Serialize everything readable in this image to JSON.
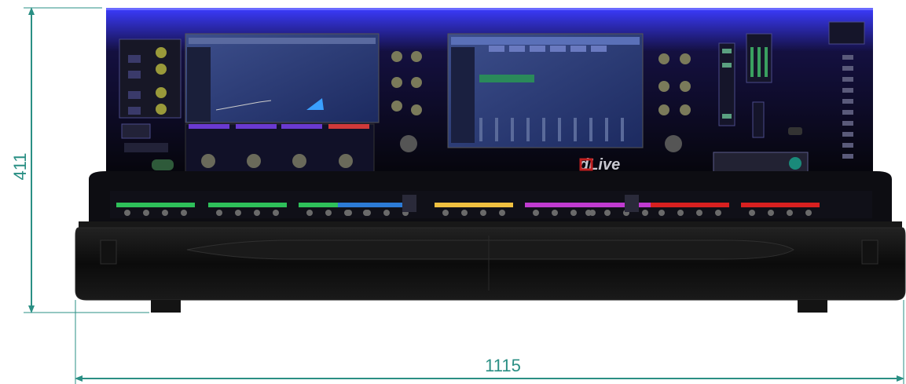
{
  "diagram": {
    "height_dimension": "411",
    "width_dimension": "1115",
    "brand_logo": "dLive",
    "dimension_color": "#2a8f84",
    "accent_color": "#3d3dff",
    "strip_colors": [
      "#2ec05a",
      "#2ec05a",
      "#2ec05a",
      "#2c7bd6",
      "#f0c040",
      "#c03bd0",
      "#c03bd0",
      "#d82020",
      "#d82020"
    ]
  }
}
